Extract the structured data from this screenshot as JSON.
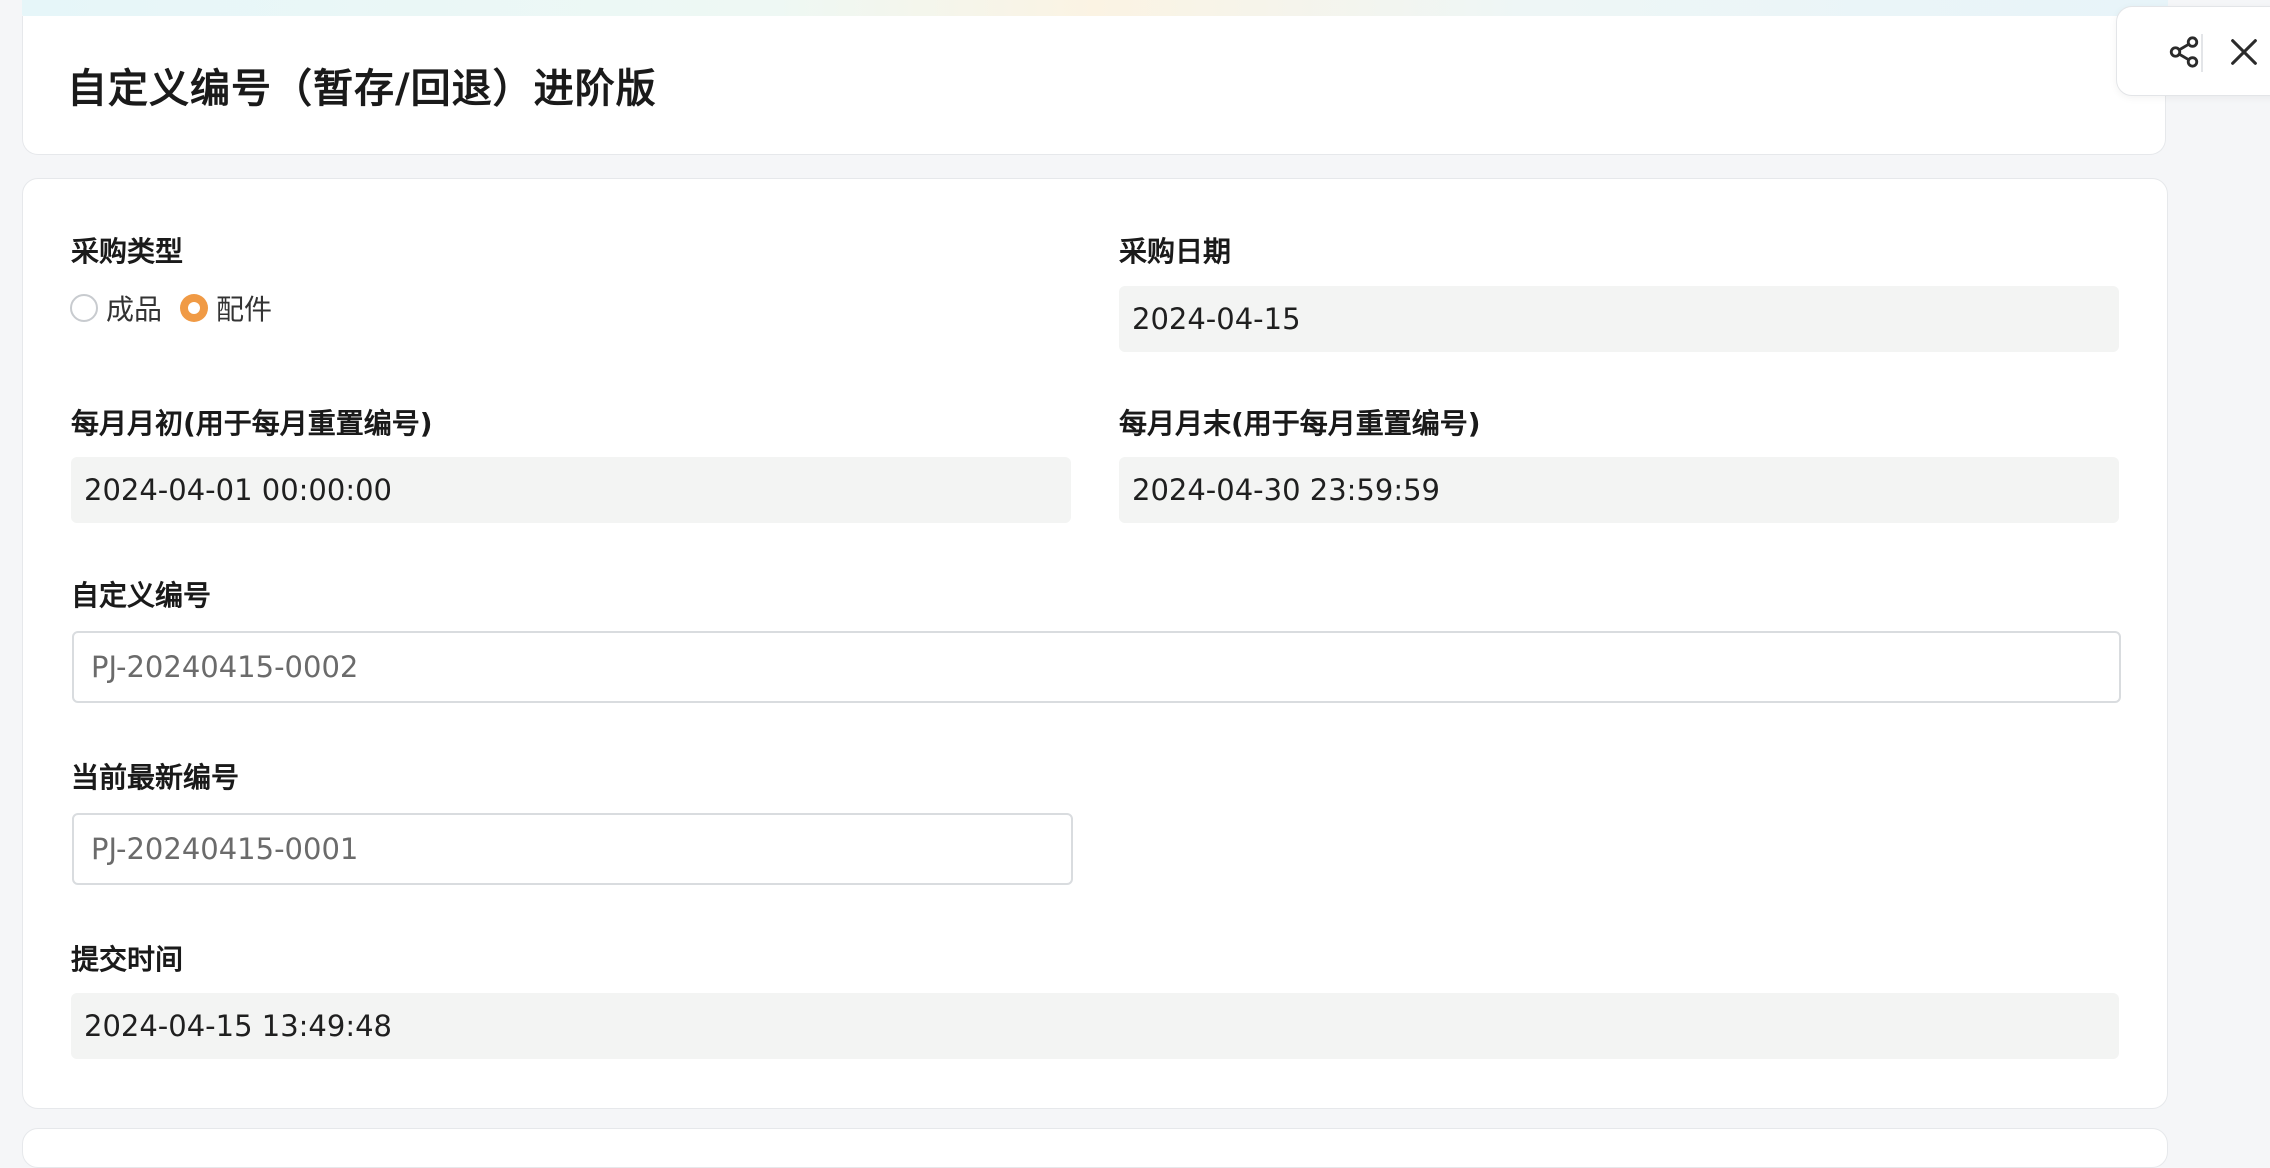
{
  "page": {
    "title": "自定义编号（暂存/回退）进阶版",
    "accent_color": "#f09a45"
  },
  "actions": {
    "share_icon": "share-icon",
    "close_icon": "close-icon"
  },
  "form": {
    "purchase_type": {
      "label": "采购类型",
      "options": [
        {
          "label": "成品",
          "selected": false
        },
        {
          "label": "配件",
          "selected": true
        }
      ]
    },
    "purchase_date": {
      "label": "采购日期",
      "value": "2024-04-15"
    },
    "month_start": {
      "label": "每月月初(用于每月重置编号)",
      "value": "2024-04-01 00:00:00"
    },
    "month_end": {
      "label": "每月月末(用于每月重置编号)",
      "value": "2024-04-30 23:59:59"
    },
    "custom_number": {
      "label": "自定义编号",
      "value": "PJ-20240415-0002"
    },
    "latest_number": {
      "label": "当前最新编号",
      "value": "PJ-20240415-0001"
    },
    "submit_time": {
      "label": "提交时间",
      "value": "2024-04-15 13:49:48"
    }
  }
}
